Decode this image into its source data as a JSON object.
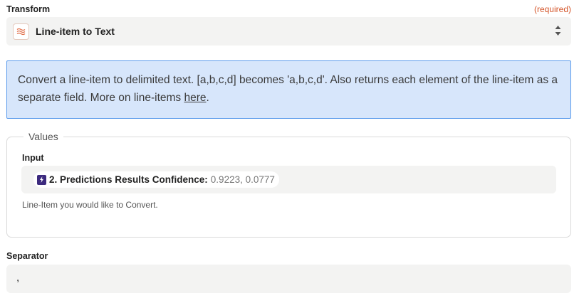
{
  "transform": {
    "label": "Transform",
    "required_text": "(required)",
    "selected": "Line-item to Text",
    "app_icon": "formatter-icon",
    "accent_color": "#d4562b"
  },
  "info": {
    "text": "Convert a line-item to delimited text. [a,b,c,d] becomes 'a,b,c,d'. Also returns each element of the line-item as a separate field. More on line-items ",
    "link_text": "here",
    "end": "."
  },
  "values": {
    "legend": "Values",
    "input_label": "Input",
    "pill_name": "2. Predictions Results Confidence:",
    "pill_value": "0.9223, 0.0777",
    "pill_icon": "zap-icon",
    "help": "Line-Item you would like to Convert."
  },
  "separator": {
    "label": "Separator",
    "value": ","
  }
}
